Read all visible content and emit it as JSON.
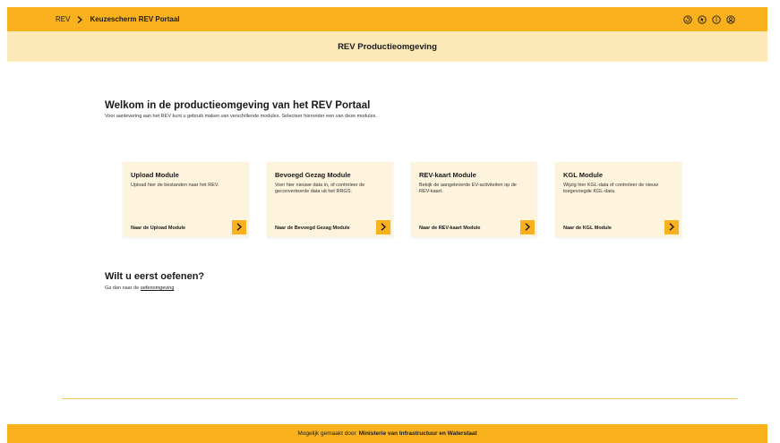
{
  "header": {
    "breadcrumb_root": "REV",
    "breadcrumb_current": "Keuzescherm REV Portaal",
    "icons": [
      "refresh-icon",
      "cursor-icon",
      "info-icon",
      "user-icon"
    ]
  },
  "environment": {
    "title": "REV Productieomgeving"
  },
  "welcome": {
    "title": "Welkom in de productieomgeving van het REV Portaal",
    "text": "Voor aanlevering aan het REV kunt u gebruik maken van verschillende modules. Selecteer hieronder een van deze modules."
  },
  "modules": [
    {
      "title": "Upload Module",
      "description": "Upload hier de bestanden naar het REV.",
      "link": "Naar de Upload Module"
    },
    {
      "title": "Bevoegd Gezag Module",
      "description": "Voer hier nieuwe data in, of controleer de geconverteerde data uit het RRGS.",
      "link": "Naar de Bevoegd Gezag Module"
    },
    {
      "title": "REV-kaart Module",
      "description": "Bekijk de aangeleverde EV-activiteiten op de REV-kaart.",
      "link": "Naar de REV-kaart Module"
    },
    {
      "title": "KGL Module",
      "description": "Wijzig hier KGL-data of controleer de nieuw toegevoegde KGL-data",
      "link": "Naar de KGL Module"
    }
  ],
  "practice": {
    "title": "Wilt u eerst oefenen?",
    "prefix": "Ga dan naar de",
    "link": "oefenomgeving"
  },
  "footer": {
    "prefix": "Mogelijk gemaakt door",
    "organization": "Ministerie van Infrastructuur en Waterstaat"
  },
  "colors": {
    "accent": "#f9b21e",
    "env_bar": "#fde9b8",
    "card_bg": "#fef3dc"
  }
}
